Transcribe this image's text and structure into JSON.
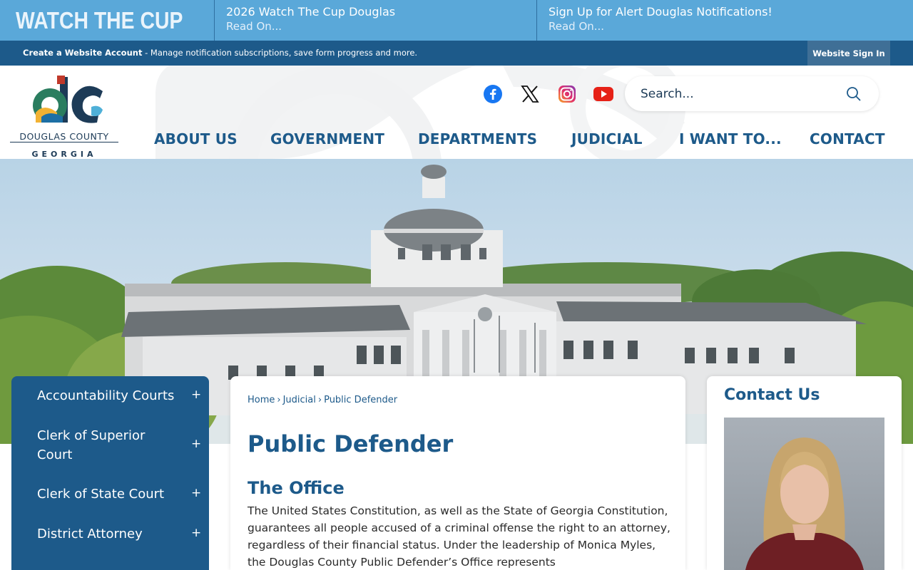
{
  "alert_bar": {
    "brand": "WATCH THE CUP",
    "items": [
      {
        "title": "2026 Watch The Cup Douglas",
        "link": "Read On..."
      },
      {
        "title": "Sign Up for Alert Douglas Notifications!",
        "link": "Read On..."
      }
    ]
  },
  "account_bar": {
    "strong": "Create a Website Account",
    "text": " - Manage notification subscriptions, save form progress and more.",
    "signin": "Website Sign In"
  },
  "logo": {
    "line1": "DOUGLAS COUNTY",
    "line2": "GEORGIA"
  },
  "social": [
    "facebook-icon",
    "x-icon",
    "instagram-icon",
    "youtube-icon"
  ],
  "search": {
    "placeholder": "Search..."
  },
  "nav": [
    "ABOUT US",
    "GOVERNMENT",
    "DEPARTMENTS",
    "JUDICIAL",
    "I WANT TO...",
    "CONTACT"
  ],
  "sidebar": {
    "items": [
      {
        "label": "Accountability Courts",
        "expand": "+"
      },
      {
        "label": "Clerk of Superior Court",
        "expand": "+"
      },
      {
        "label": "Clerk of State Court",
        "expand": "+"
      },
      {
        "label": "District Attorney",
        "expand": "+"
      }
    ]
  },
  "breadcrumb": [
    "Home",
    "Judicial",
    "Public Defender"
  ],
  "breadcrumb_sep": "›",
  "page_title": "Public Defender",
  "section": {
    "title": "The Office",
    "body": "The United States Constitution, as well as the State of Georgia Constitution, guarantees all people accused of a criminal offense the right to an attorney, regardless of their financial status. Under the leadership of Monica Myles, the Douglas County Public Defender’s Office represents"
  },
  "contact": {
    "title": "Contact Us"
  },
  "colors": {
    "alert_bg": "#5aa8d9",
    "account_bg": "#1d5a8a",
    "primary": "#1d5a8a",
    "sidebar_bg": "#1d5a8a"
  }
}
